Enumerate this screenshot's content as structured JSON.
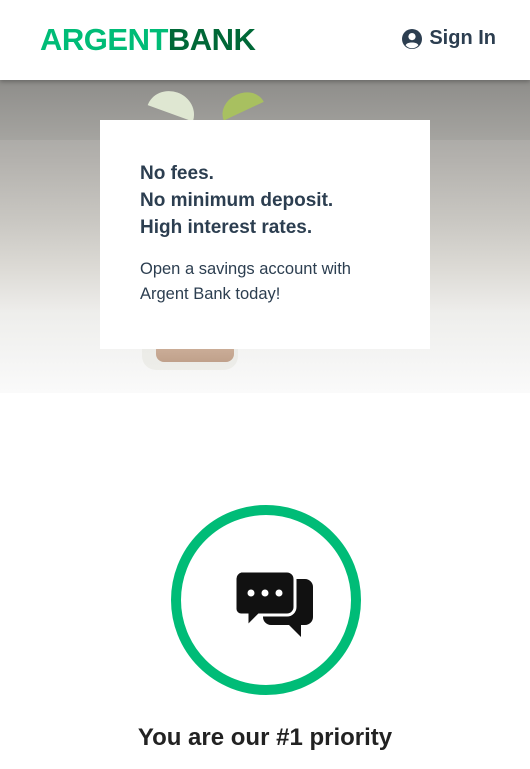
{
  "header": {
    "logo_part1": "ARGENT",
    "logo_part2": "BANK",
    "signin_label": "Sign In",
    "signin_icon": "user-circle-icon"
  },
  "hero": {
    "lines": [
      "No fees.",
      "No minimum deposit.",
      "High interest rates."
    ],
    "description": "Open a savings account with Argent Bank today!"
  },
  "feature": {
    "icon": "chat-icon",
    "title": "You are our #1 priority"
  },
  "colors": {
    "brand_green": "#00bc77",
    "brand_dark_green": "#006837",
    "text": "#2c3e50"
  }
}
